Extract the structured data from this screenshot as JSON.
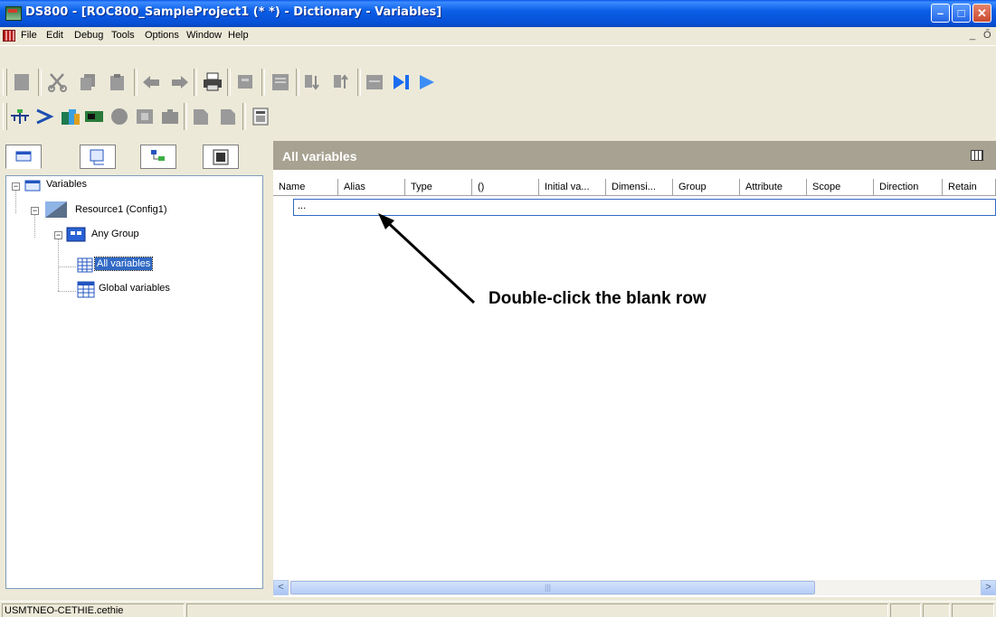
{
  "window": {
    "title": "DS800 - [ROC800_SampleProject1 (*  *) - Dictionary - Variables]",
    "minimize_glyph": "–",
    "maximize_glyph": "□",
    "close_glyph": "✕"
  },
  "menu": {
    "items": [
      "File",
      "Edit",
      "Debug",
      "Tools",
      "Options",
      "Window",
      "Help"
    ],
    "mdi_minimize": "_",
    "mdi_restore": "Ő"
  },
  "toolbar1": {
    "icons": [
      "new-icon",
      "cut-icon",
      "copy-icon",
      "paste-icon",
      "undo-icon",
      "redo-icon",
      "print-icon",
      "find-icon",
      "properties-icon",
      "sort-ascending-icon",
      "sort-descending-icon",
      "grid-view-icon",
      "step-icon",
      "run-icon"
    ]
  },
  "toolbar2": {
    "icons": [
      "network-icon",
      "link-icon",
      "library-icon",
      "board-icon",
      "circle-icon",
      "frame-icon",
      "puzzle-icon",
      "document-icon",
      "document2-icon",
      "calculator-icon"
    ]
  },
  "left_panel": {
    "tabs": [
      "variables-tab",
      "resources-tab",
      "hierarchy-tab",
      "panel-tab"
    ],
    "tree": [
      {
        "label": "Variables",
        "expander": "−"
      },
      {
        "label": "Resource1 (Config1)",
        "expander": "−"
      },
      {
        "label": "Any Group",
        "expander": "−"
      },
      {
        "label": "All variables",
        "selected": true
      },
      {
        "label": "Global variables"
      }
    ]
  },
  "right_panel": {
    "title": "All variables",
    "columns": [
      "Name",
      "Alias",
      "Type",
      "()",
      "Initial va...",
      "Dimensi...",
      "Group",
      "Attribute",
      "Scope",
      "Direction",
      "Retain"
    ],
    "rows": [
      {
        "name": "..."
      }
    ]
  },
  "annotation": {
    "text": "Double-click the blank row"
  },
  "scrollbar": {
    "left_arrow": "<",
    "right_arrow": ">"
  },
  "status": {
    "text": "USMTNEO-CETHIE.cethie"
  },
  "colors": {
    "title_bar": "#0b5fe6",
    "panel_header": "#a7a291",
    "selection": "#316ac5"
  }
}
